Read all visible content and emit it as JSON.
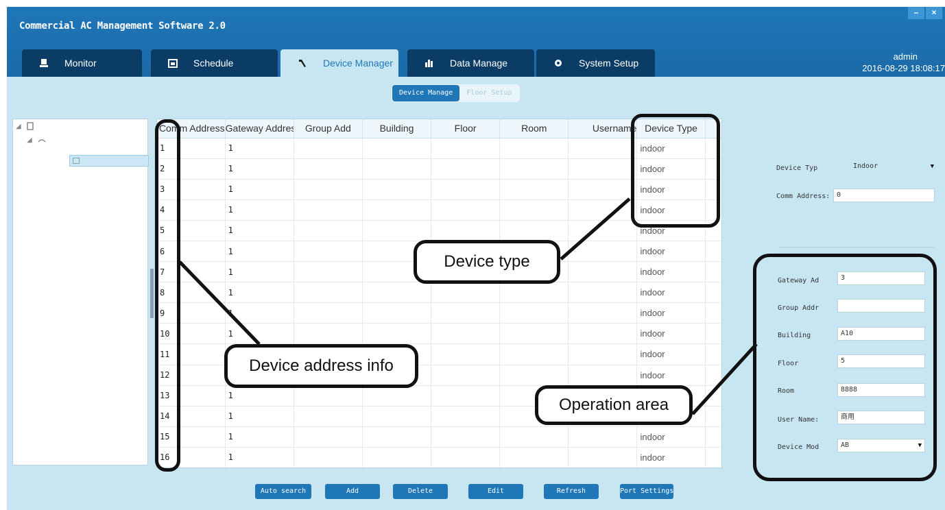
{
  "app": {
    "title": "Commercial AC Management Software 2.0",
    "user": "admin",
    "datetime": "2016-08-29 18:08:17",
    "window_controls": [
      "–",
      "×"
    ]
  },
  "tabs": [
    {
      "label": "Monitor",
      "icon": "monitor-icon"
    },
    {
      "label": "Schedule",
      "icon": "calendar-icon"
    },
    {
      "label": "Device Manager",
      "icon": "wrench-icon",
      "active": true
    },
    {
      "label": "Data Manage",
      "icon": "bar-chart-icon"
    },
    {
      "label": "System Setup",
      "icon": "gear-icon"
    }
  ],
  "subtabs": [
    {
      "label": "Device Manage",
      "active": true
    },
    {
      "label": "Floor Setup"
    }
  ],
  "table": {
    "columns": [
      "Comm Address",
      "Gateway Address",
      "Group Add",
      "Building",
      "Floor",
      "Room",
      "Username",
      "Device Type",
      "",
      ""
    ],
    "rows": [
      [
        "1",
        "1",
        "",
        "",
        "",
        "",
        "",
        "indoor",
        "",
        ""
      ],
      [
        "2",
        "1",
        "",
        "",
        "",
        "",
        "",
        "indoor",
        "",
        ""
      ],
      [
        "3",
        "1",
        "",
        "",
        "",
        "",
        "",
        "indoor",
        "",
        ""
      ],
      [
        "4",
        "1",
        "",
        "",
        "",
        "",
        "",
        "indoor",
        "",
        ""
      ],
      [
        "5",
        "1",
        "",
        "",
        "",
        "",
        "",
        "indoor",
        "",
        ""
      ],
      [
        "6",
        "1",
        "",
        "",
        "",
        "",
        "",
        "indoor",
        "",
        ""
      ],
      [
        "7",
        "1",
        "",
        "",
        "",
        "",
        "",
        "indoor",
        "",
        ""
      ],
      [
        "8",
        "1",
        "",
        "",
        "",
        "",
        "",
        "indoor",
        "",
        ""
      ],
      [
        "9",
        "1",
        "",
        "",
        "",
        "",
        "",
        "indoor",
        "",
        ""
      ],
      [
        "10",
        "1",
        "",
        "",
        "",
        "",
        "",
        "indoor",
        "",
        ""
      ],
      [
        "11",
        "1",
        "",
        "",
        "",
        "",
        "",
        "indoor",
        "",
        ""
      ],
      [
        "12",
        "1",
        "",
        "",
        "",
        "",
        "",
        "indoor",
        "",
        ""
      ],
      [
        "13",
        "1",
        "",
        "",
        "",
        "",
        "",
        "indoor",
        "",
        ""
      ],
      [
        "14",
        "1",
        "",
        "",
        "",
        "",
        "",
        "indoor",
        "",
        ""
      ],
      [
        "15",
        "1",
        "",
        "",
        "",
        "",
        "",
        "indoor",
        "",
        ""
      ],
      [
        "16",
        "1",
        "",
        "",
        "",
        "",
        "",
        "indoor",
        "",
        ""
      ]
    ]
  },
  "panel": {
    "device_type_label": "Device Typ",
    "device_type_value": "Indoor",
    "comm_address_label": "Comm Address:",
    "comm_address_value": "0",
    "gateway_label": "Gateway Ad",
    "gateway_value": "3",
    "group_label": "Group Addr",
    "group_value": "",
    "building_label": "Building",
    "building_value": "A10",
    "floor_label": "Floor",
    "floor_value": "5",
    "room_label": "Room",
    "room_value": "8888",
    "username_label": "User Name:",
    "username_value": "商用",
    "device_model_label": "Device Mod",
    "device_model_value": "AB"
  },
  "buttons": {
    "auto_search": "Auto search",
    "add": "Add",
    "delete": "Delete",
    "edit": "Edit",
    "refresh": "Refresh",
    "port_settings": "Port Settings"
  },
  "annotations": {
    "device_type": "Device type",
    "device_address_info": "Device address info",
    "operation_area": "Operation area"
  }
}
